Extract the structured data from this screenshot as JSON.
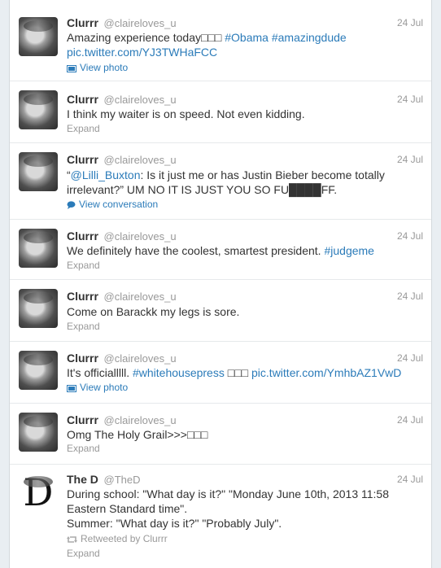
{
  "tweets": [
    {
      "name": "Clurrr",
      "handle": "@claireloves_u",
      "date": "24 Jul",
      "parts": [
        {
          "text": "Amazing experience today□□□ ",
          "link": false
        },
        {
          "text": "#Obama",
          "link": true
        },
        {
          "text": " ",
          "link": false
        },
        {
          "text": "#amazingdude",
          "link": true
        },
        {
          "text": " pic.twitter.com/YJ3TWHaFCC",
          "link": true
        }
      ],
      "action": "View photo",
      "action_icon": "photo-icon"
    },
    {
      "name": "Clurrr",
      "handle": "@claireloves_u",
      "date": "24 Jul",
      "parts": [
        {
          "text": "I think my waiter is on speed. Not even kidding.",
          "link": false
        }
      ],
      "action": "Expand"
    },
    {
      "name": "Clurrr",
      "handle": "@claireloves_u",
      "date": "24 Jul",
      "parts": [
        {
          "text": "“",
          "link": false
        },
        {
          "text": "@Lilli_Buxton",
          "link": true
        },
        {
          "text": ": Is it just me or has Justin Bieber become totally irrelevant?” UM NO IT IS JUST YOU SO FU████FF.",
          "link": false
        }
      ],
      "action": "View conversation",
      "action_icon": "speech-bubble-icon"
    },
    {
      "name": "Clurrr",
      "handle": "@claireloves_u",
      "date": "24 Jul",
      "parts": [
        {
          "text": "We definitely have the coolest, smartest president. ",
          "link": false
        },
        {
          "text": "#judgeme",
          "link": true
        }
      ],
      "action": "Expand"
    },
    {
      "name": "Clurrr",
      "handle": "@claireloves_u",
      "date": "24 Jul",
      "parts": [
        {
          "text": "Come on Barackk my legs is sore.",
          "link": false
        }
      ],
      "action": "Expand"
    },
    {
      "name": "Clurrr",
      "handle": "@claireloves_u",
      "date": "24 Jul",
      "parts": [
        {
          "text": "It's officialllll. ",
          "link": false
        },
        {
          "text": "#whitehousepress",
          "link": true
        },
        {
          "text": " □□□ ",
          "link": false
        },
        {
          "text": "pic.twitter.com/YmhbAZ1VwD",
          "link": true
        }
      ],
      "action": "View photo",
      "action_icon": "photo-icon"
    },
    {
      "name": "Clurrr",
      "handle": "@claireloves_u",
      "date": "24 Jul",
      "parts": [
        {
          "text": "Omg The Holy Grail>>>□□□",
          "link": false
        }
      ],
      "action": "Expand"
    },
    {
      "name": "The D",
      "handle": "@TheD",
      "date": "24 Jul",
      "avatar_letter": "D",
      "lines": [
        "During school: \"What day is it?\" \"Monday June 10th, 2013 11:58 Eastern Standard time\".",
        "Summer: \"What day is it?\" \"Probably July\"."
      ],
      "retweeted_by": "Retweeted by Clurrr",
      "action": "Expand"
    }
  ]
}
